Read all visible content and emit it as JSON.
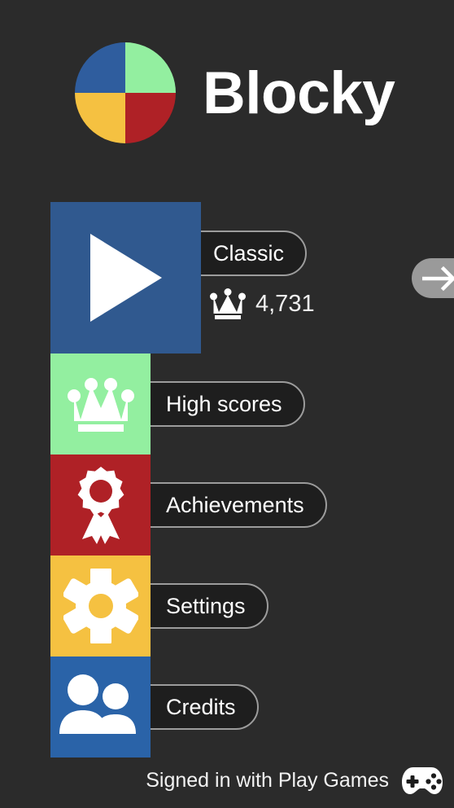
{
  "app": {
    "title": "Blocky",
    "background_color": "#2b2b2b",
    "logo": {
      "name": "blocky-logo",
      "quadrants": [
        {
          "name": "top-left",
          "color": "#2f5d9e"
        },
        {
          "name": "top-right",
          "color": "#93efa0"
        },
        {
          "name": "bottom-left",
          "color": "#f5c141"
        },
        {
          "name": "bottom-right",
          "color": "#af2126"
        }
      ]
    }
  },
  "menu": {
    "items": [
      {
        "id": "classic",
        "label": "Classic",
        "icon": "play-icon",
        "tile_color": "#30598f",
        "size": "large",
        "score": {
          "icon": "crown-icon",
          "value": "4,731"
        }
      },
      {
        "id": "high-scores",
        "label": "High scores",
        "icon": "crown-icon",
        "tile_color": "#93efa0",
        "size": "small"
      },
      {
        "id": "achievements",
        "label": "Achievements",
        "icon": "award-rosette-icon",
        "tile_color": "#af2126",
        "size": "small"
      },
      {
        "id": "settings",
        "label": "Settings",
        "icon": "gear-icon",
        "tile_color": "#f5c141",
        "size": "small"
      },
      {
        "id": "credits",
        "label": "Credits",
        "icon": "people-icon",
        "tile_color": "#2a63a8",
        "size": "small"
      }
    ],
    "pill_fill": "#1e1e1e",
    "pill_border": "#9c9c9c"
  },
  "next_button": {
    "name": "next-mode-button",
    "icon": "arrow-right-icon",
    "color": "#9a9a9a"
  },
  "footer": {
    "status_text": "Signed in with Play Games",
    "icon": "gamepad-icon"
  }
}
